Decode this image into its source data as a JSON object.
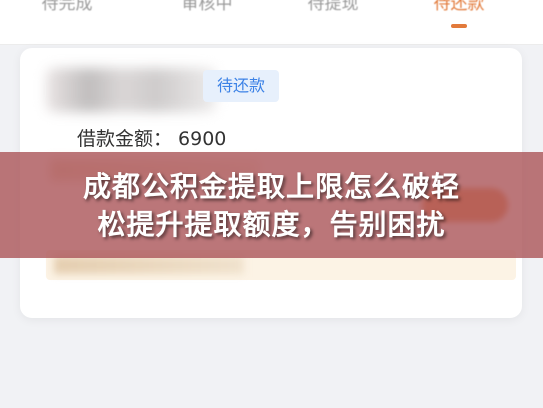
{
  "tabs": [
    {
      "label": "待完成",
      "active": false
    },
    {
      "label": "审核中",
      "active": false
    },
    {
      "label": "待提现",
      "active": false
    },
    {
      "label": "待还款",
      "active": true
    }
  ],
  "loan_card": {
    "status": "待还款",
    "amount_label": "借款金额：",
    "amount_value": "6900"
  },
  "overlay": {
    "headline_line1": "成都公积金提取上限怎么破轻",
    "headline_line2": "松提升提取额度，告别困扰"
  },
  "colors": {
    "accent": "#e27a3b",
    "status_blue": "#3c82e6",
    "overlay_red": "#ac585c"
  }
}
